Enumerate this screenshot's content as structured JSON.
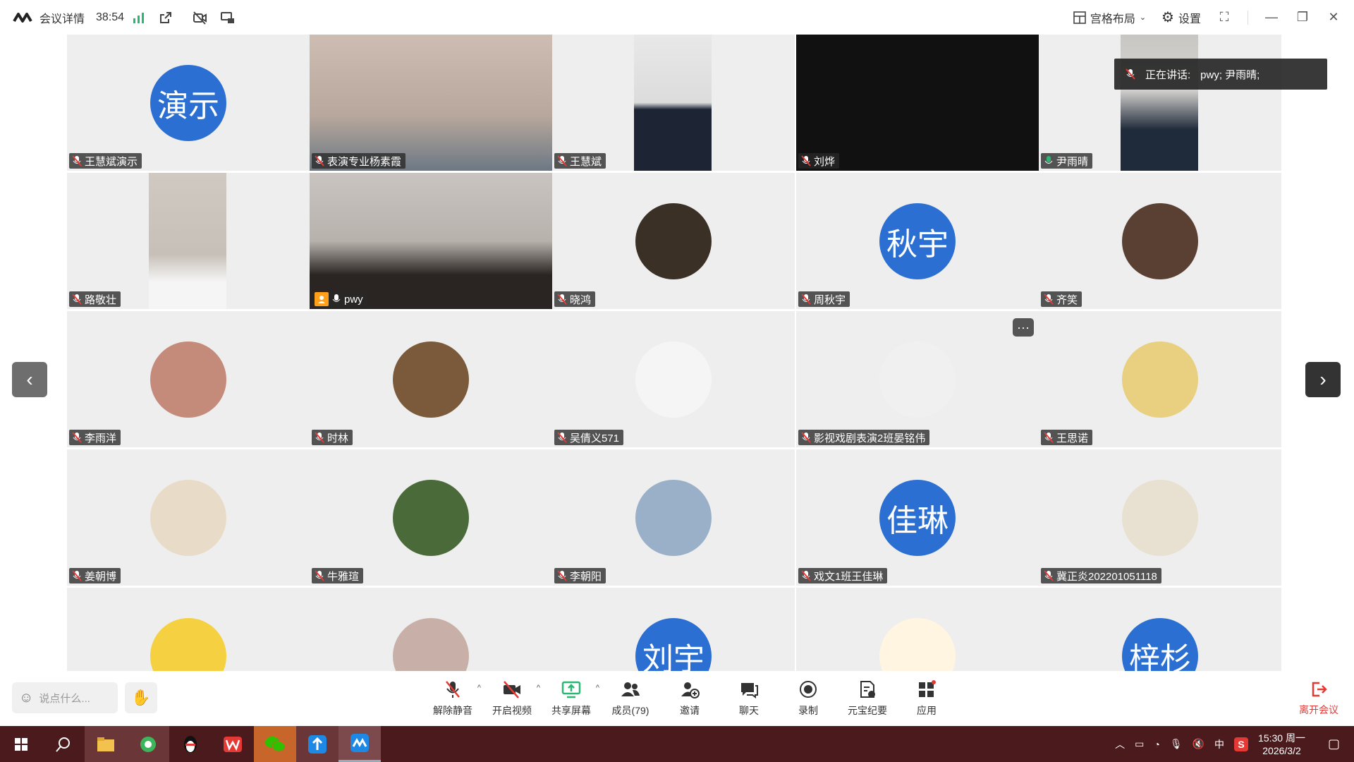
{
  "topbar": {
    "meeting_info": "会议详情",
    "timer": "38:54",
    "layout_label": "宫格布局",
    "settings_label": "设置"
  },
  "speaking": {
    "label": "正在讲话:",
    "names": "pwy; 尹雨晴;"
  },
  "tiles": [
    {
      "name": "王慧斌演示",
      "avatar_text": "演示",
      "kind": "text"
    },
    {
      "name": "表演专业杨素霞",
      "kind": "photo",
      "photo": "woman-video"
    },
    {
      "name": "王慧斌",
      "kind": "photo",
      "photo": "man-video"
    },
    {
      "name": "刘烨",
      "kind": "black"
    },
    {
      "name": "尹雨晴",
      "kind": "photo",
      "photo": "person-video"
    },
    {
      "name": "路敬壮",
      "kind": "photo",
      "photo": "person-video"
    },
    {
      "name": "pwy",
      "kind": "photo",
      "photo": "woman-glasses-video"
    },
    {
      "name": "晓鸿",
      "kind": "avatar-img",
      "color": "#3a3026"
    },
    {
      "name": "周秋宇",
      "avatar_text": "秋宇",
      "kind": "text"
    },
    {
      "name": "齐笑",
      "kind": "avatar-img",
      "color": "#5a4032"
    },
    {
      "name": "李雨洋",
      "kind": "avatar-img",
      "color": "#c48a7a"
    },
    {
      "name": "时林",
      "kind": "avatar-img",
      "color": "#7a5a3a"
    },
    {
      "name": "吴倩义571",
      "kind": "avatar-img",
      "color": "#f5f5f5"
    },
    {
      "name": "影视戏剧表演2班晏铭伟",
      "kind": "avatar-img",
      "color": "#f0f0f0"
    },
    {
      "name": "王思诺",
      "kind": "avatar-img",
      "color": "#e8d080"
    },
    {
      "name": "姜朝博",
      "kind": "avatar-img",
      "color": "#e8dcc8"
    },
    {
      "name": "牛雅瑄",
      "kind": "avatar-img",
      "color": "#4a6a3a"
    },
    {
      "name": "李朝阳",
      "kind": "avatar-img",
      "color": "#9ab0c8"
    },
    {
      "name": "戏文1班王佳琳",
      "avatar_text": "佳琳",
      "kind": "text"
    },
    {
      "name": "冀正炎202201051118",
      "kind": "avatar-img",
      "color": "#e8e0d0"
    },
    {
      "name": "",
      "kind": "avatar-img",
      "color": "#f5d040"
    },
    {
      "name": "",
      "kind": "avatar-img",
      "color": "#c8b0a8"
    },
    {
      "name": "",
      "avatar_text": "刘宇",
      "kind": "text"
    },
    {
      "name": "",
      "kind": "avatar-img",
      "color": "#fff5e0"
    },
    {
      "name": "",
      "avatar_text": "梓杉",
      "kind": "text"
    }
  ],
  "chat": {
    "placeholder": "说点什么..."
  },
  "toolbar": [
    {
      "label": "解除静音",
      "icon": "mic-muted-icon",
      "caret": true
    },
    {
      "label": "开启视频",
      "icon": "video-off-icon",
      "caret": true
    },
    {
      "label": "共享屏幕",
      "icon": "share-screen-icon",
      "caret": true
    },
    {
      "label": "成员(79)",
      "icon": "members-icon",
      "caret": false
    },
    {
      "label": "邀请",
      "icon": "invite-icon",
      "caret": false
    },
    {
      "label": "聊天",
      "icon": "chat-icon",
      "caret": false
    },
    {
      "label": "录制",
      "icon": "record-icon",
      "caret": false
    },
    {
      "label": "元宝纪要",
      "icon": "minutes-icon",
      "caret": false
    },
    {
      "label": "应用",
      "icon": "apps-icon",
      "caret": false
    }
  ],
  "leave": {
    "label": "离开会议"
  },
  "taskbar": {
    "ime": "中",
    "time": "15:30 周一",
    "date": "2026/3/2"
  },
  "colors": {
    "accent": "#2a6fd1",
    "active_border": "#33cc88",
    "leave": "#e53935",
    "taskbar": "#4a1a1c"
  }
}
